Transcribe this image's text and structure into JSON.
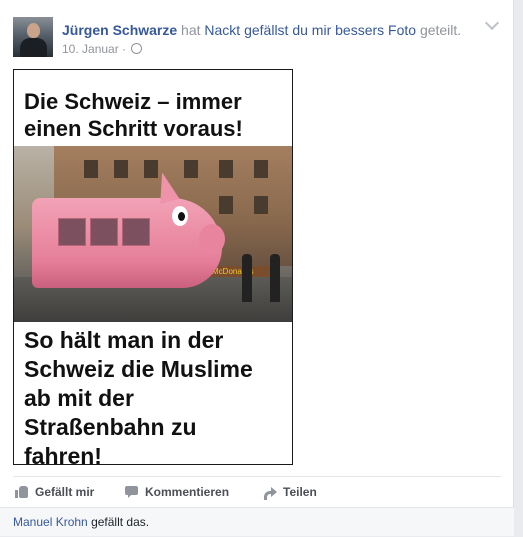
{
  "post": {
    "author": "Jürgen Schwarze",
    "verb_part1": "hat",
    "page_name": "Nackt gefällst du mir besser",
    "verb_part2_link": "s Foto",
    "verb_part3": "geteilt.",
    "timestamp": "10. Januar",
    "separator": "·",
    "privacy_icon": "globe-icon",
    "menu_icon": "chevron-down-icon"
  },
  "photo": {
    "caption_top": "Die Schweiz – immer\neinen Schritt voraus!",
    "caption_bottom": "So hält man in der\nSchweiz die Muslime\nab mit der\nStraßenbahn zu\nfahren!"
  },
  "actions": {
    "like_label": "Gefällt mir",
    "comment_label": "Kommentieren",
    "share_label": "Teilen"
  },
  "likes": {
    "user": "Manuel Krohn",
    "suffix": "gefällt das."
  },
  "colors": {
    "link": "#365899",
    "meta": "#90949c",
    "action_text": "#4b4f56"
  }
}
